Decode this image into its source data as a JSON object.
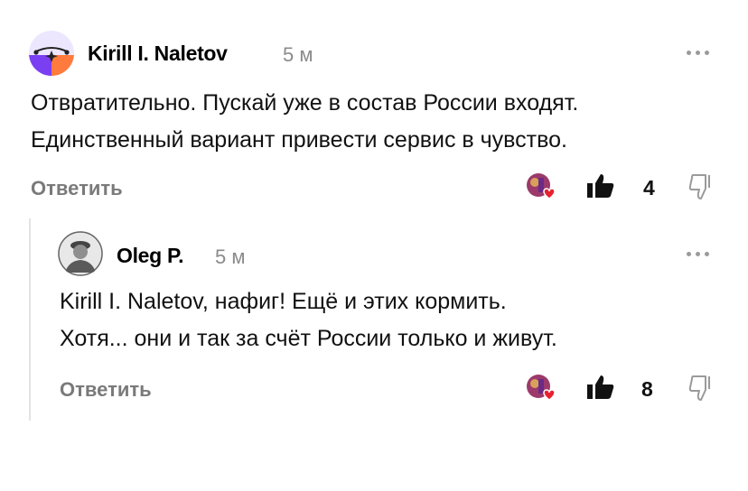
{
  "comments": [
    {
      "author": "Kirill I. Naletov",
      "time": "5 м",
      "lines": [
        "Отвратительно. Пускай уже в состав России входят.",
        "Единственный вариант привести сервис в чувство."
      ],
      "reply_label": "Ответить",
      "likes": "4"
    },
    {
      "author": "Oleg P.",
      "time": "5 м",
      "lines": [
        "Kirill I. Naletov, нафиг! Ещё и этих кормить.",
        "Хотя... они и так за счёт России только и живут."
      ],
      "reply_label": "Ответить",
      "likes": "8"
    }
  ],
  "icons": {
    "more": "more-options-icon",
    "like": "thumbs-up-icon",
    "dislike": "thumbs-down-icon",
    "reactions": "reactions-icon"
  },
  "colors": {
    "avatar_purple": "#7b3ff2",
    "avatar_orange": "#ff7a3d",
    "muted_text": "#7a7a7a",
    "heart_red": "#e8202f"
  }
}
